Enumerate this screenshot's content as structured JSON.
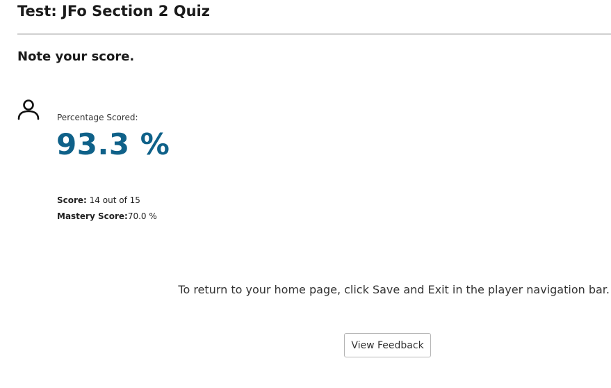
{
  "test": {
    "title": "Test: JFo Section 2 Quiz"
  },
  "result": {
    "heading": "Note your score.",
    "avatar_icon": "user-icon",
    "percentage_label": "Percentage Scored:",
    "percentage_value": "93.3 %",
    "percentage_color": "#0f6189",
    "score_label": "Score:",
    "score_value": " 14 out of 15",
    "mastery_label": "Mastery Score:",
    "mastery_value": "70.0 %"
  },
  "footer": {
    "return_note": "To return to your home page, click Save and Exit in the player navigation bar.",
    "view_feedback_label": "View Feedback"
  }
}
